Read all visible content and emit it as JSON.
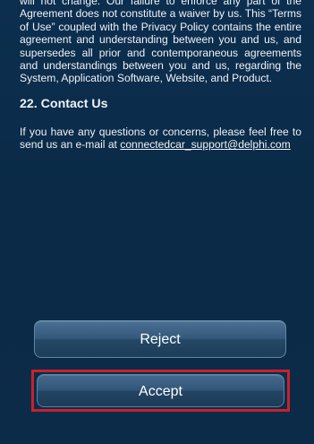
{
  "terms": {
    "paragraph": "will not change. Our failure to enforce any part of the Agreement does not constitute a waiver by us. This “Terms of Use” coupled with the Privacy Policy contains the entire agreement and understanding between you and us, and supersedes all prior and contemporaneous agreements and understandings between you and us, regarding the System, Application Software, Website, and Product."
  },
  "contact": {
    "heading": "22. Contact Us",
    "text": "If you have any questions or concerns, please feel free to send us an e-mail at ",
    "email": "connectedcar_support@delphi.com"
  },
  "buttons": {
    "reject_label": "Reject",
    "accept_label": "Accept"
  },
  "colors": {
    "background": "#0b2b49",
    "highlight": "#c8212a"
  }
}
